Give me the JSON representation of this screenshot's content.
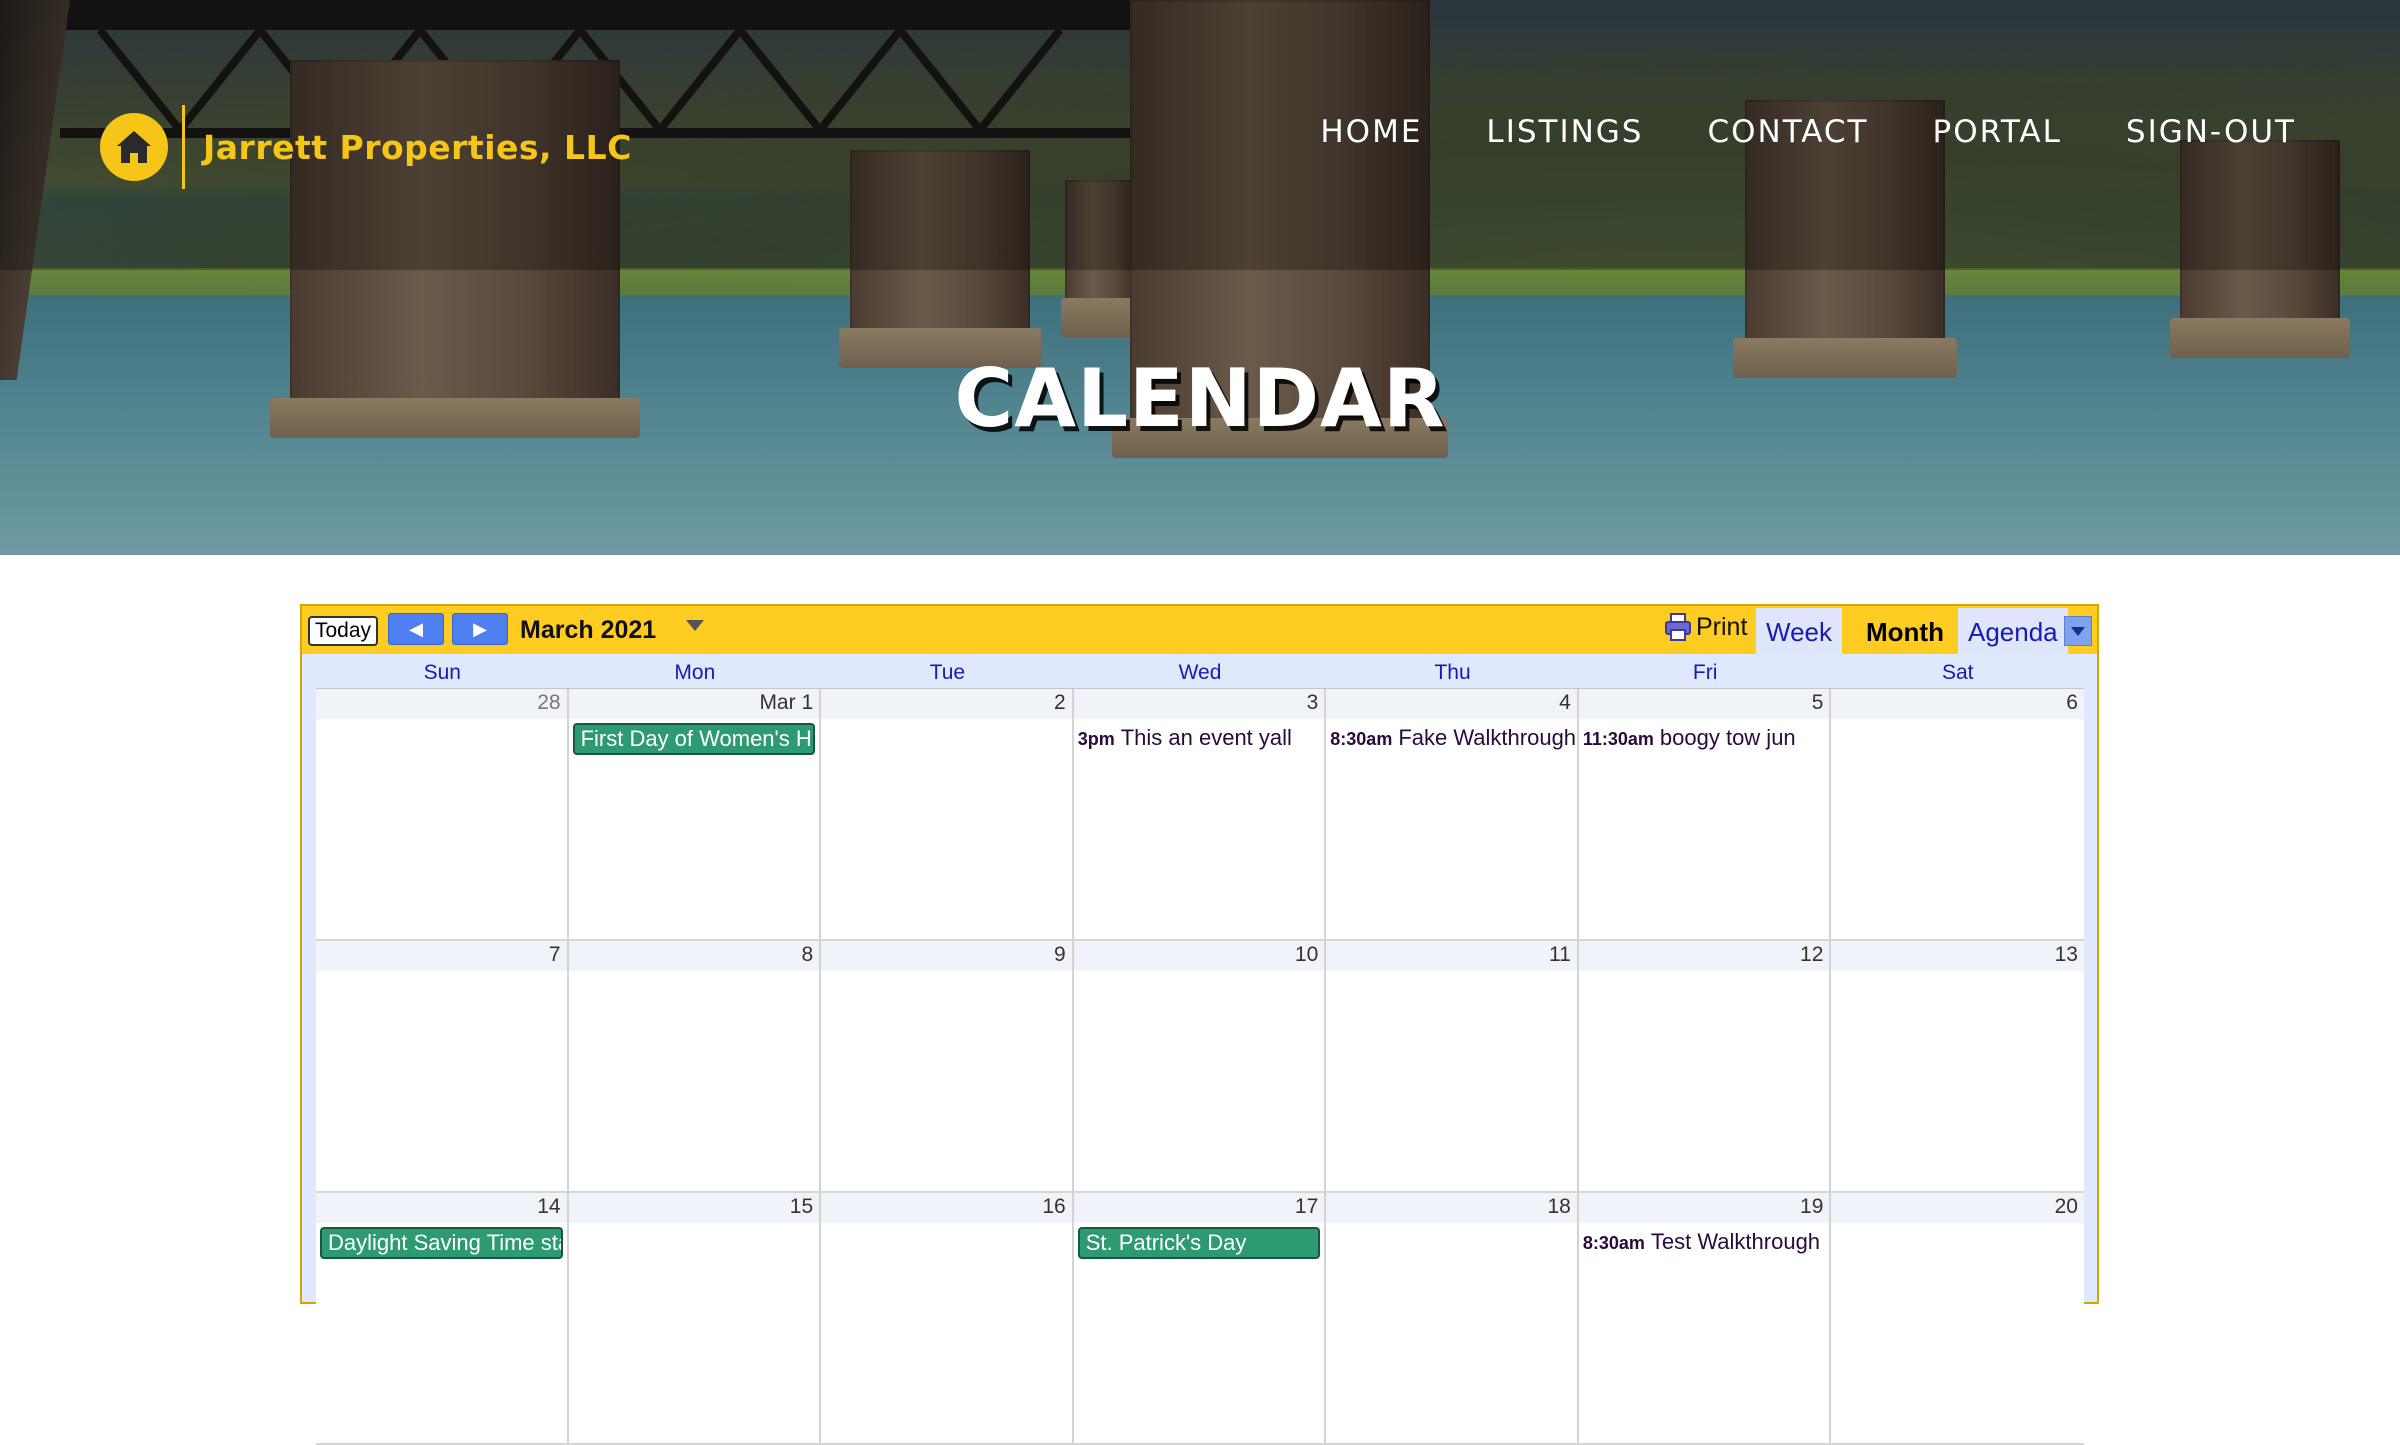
{
  "brand": {
    "name": "Jarrett Properties, LLC",
    "accent": "#f5c518"
  },
  "nav": [
    "HOME",
    "LISTINGS",
    "CONTACT",
    "PORTAL",
    "SIGN-OUT"
  ],
  "page": {
    "title": "CALENDAR"
  },
  "calendar": {
    "today_label": "Today",
    "month_label": "March 2021",
    "print_label": "Print",
    "views": {
      "week": "Week",
      "month": "Month",
      "agenda": "Agenda",
      "active": "Month"
    },
    "weekdays": [
      "Sun",
      "Mon",
      "Tue",
      "Wed",
      "Thu",
      "Fri",
      "Sat"
    ],
    "weeks": [
      {
        "days": [
          {
            "num": "28",
            "other": true
          },
          {
            "num": "Mar 1",
            "allday": "First Day of Women's History Month"
          },
          {
            "num": "2"
          },
          {
            "num": "3",
            "time": "3pm",
            "event": "This an event yall"
          },
          {
            "num": "4",
            "time": "8:30am",
            "event": "Fake Walkthrough"
          },
          {
            "num": "5",
            "time": "11:30am",
            "event": "boogy tow jun"
          },
          {
            "num": "6"
          }
        ]
      },
      {
        "days": [
          {
            "num": "7"
          },
          {
            "num": "8"
          },
          {
            "num": "9"
          },
          {
            "num": "10"
          },
          {
            "num": "11"
          },
          {
            "num": "12"
          },
          {
            "num": "13"
          }
        ]
      },
      {
        "days": [
          {
            "num": "14",
            "allday": "Daylight Saving Time starts"
          },
          {
            "num": "15"
          },
          {
            "num": "16"
          },
          {
            "num": "17",
            "allday": "St. Patrick's Day"
          },
          {
            "num": "18"
          },
          {
            "num": "19",
            "time": "8:30am",
            "event": "Test Walkthrough"
          },
          {
            "num": "20"
          }
        ]
      }
    ],
    "colors": {
      "toolbar": "#ffcc22",
      "event": "#2e9a72",
      "weekday_text": "#1a1ab0"
    }
  }
}
